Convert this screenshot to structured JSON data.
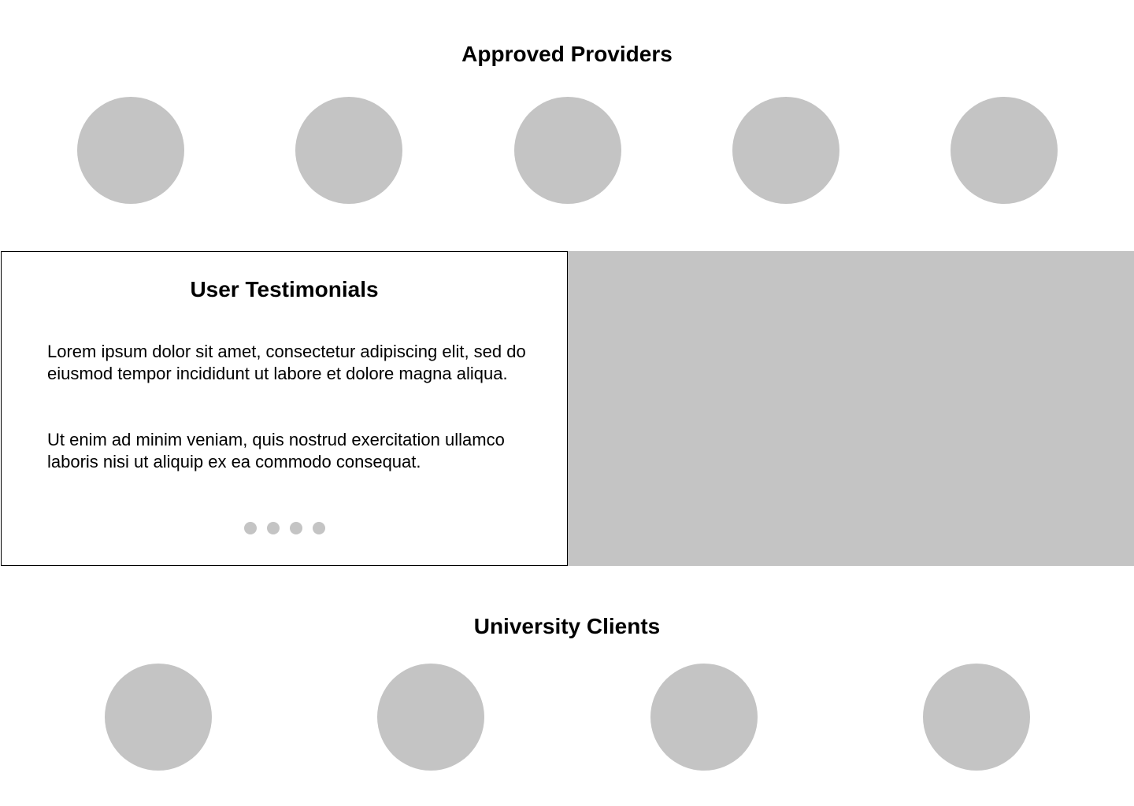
{
  "providers": {
    "title": "Approved Providers",
    "logo_count": 5
  },
  "testimonials": {
    "title": "User Testimonials",
    "paragraphs": [
      "Lorem ipsum dolor sit amet, consectetur adipiscing elit, sed do eiusmod tempor incididunt ut labore et dolore magna aliqua.",
      "Ut enim ad minim veniam, quis nostrud exercitation ullamco laboris nisi ut aliquip ex ea commodo consequat."
    ],
    "carousel_dot_count": 4
  },
  "clients": {
    "title": "University Clients",
    "logo_count": 4
  },
  "colors": {
    "placeholder": "#c4c4c4",
    "text": "#000000",
    "background": "#ffffff"
  }
}
